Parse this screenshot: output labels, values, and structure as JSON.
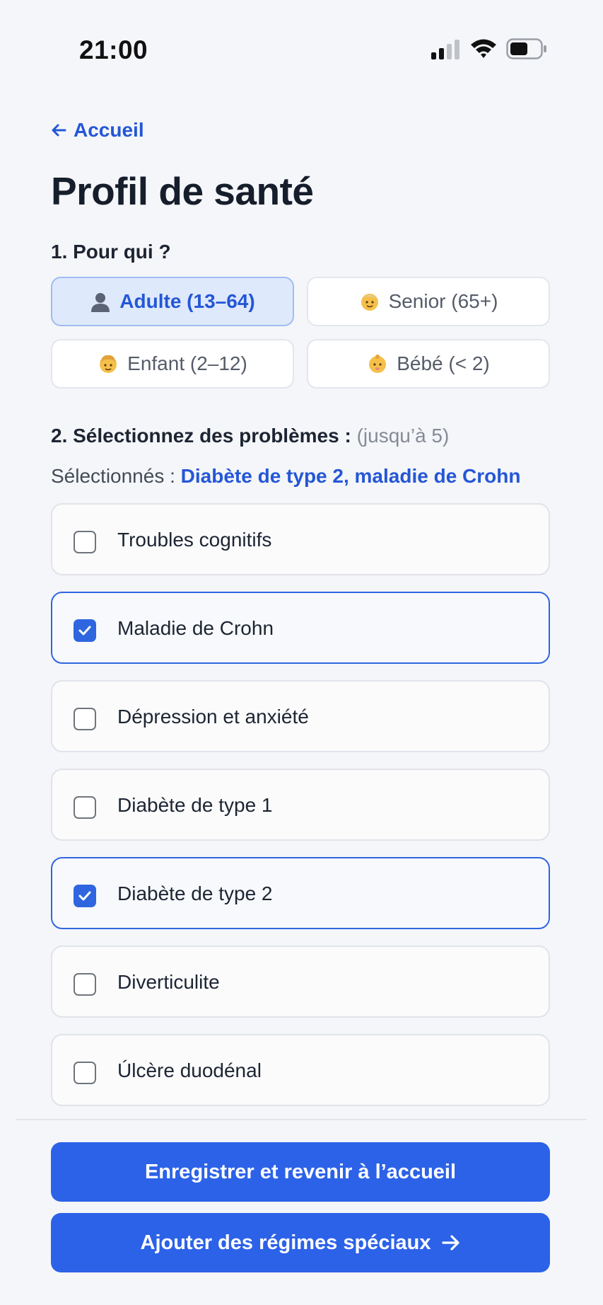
{
  "status_bar": {
    "time": "21:00"
  },
  "nav": {
    "back_label": "Accueil"
  },
  "page": {
    "title": "Profil de santé"
  },
  "who": {
    "heading": "1. Pour qui ?",
    "options": [
      {
        "label": "Adulte (13–64)",
        "icon": "adult-icon",
        "selected": true
      },
      {
        "label": "Senior (65+)",
        "icon": "senior-icon",
        "selected": false
      },
      {
        "label": "Enfant (2–12)",
        "icon": "child-icon",
        "selected": false
      },
      {
        "label": "Bébé (< 2)",
        "icon": "baby-icon",
        "selected": false
      }
    ]
  },
  "problems": {
    "heading": "2. Sélectionnez des problèmes :",
    "hint": "(jusqu’à 5)",
    "selected_prefix": "Sélectionnés :",
    "selected_value": "Diabète de type 2, maladie de Crohn",
    "items": [
      {
        "label": "Troubles cognitifs",
        "checked": false
      },
      {
        "label": "Maladie de Crohn",
        "checked": true
      },
      {
        "label": "Dépression et anxiété",
        "checked": false
      },
      {
        "label": "Diabète de type 1",
        "checked": false
      },
      {
        "label": "Diabète de type 2",
        "checked": true
      },
      {
        "label": "Diverticulite",
        "checked": false
      },
      {
        "label": "Úlcère duodénal",
        "checked": false
      }
    ]
  },
  "actions": {
    "save_label": "Enregistrer et revenir à l’accueil",
    "next_label": "Ajouter des régimes spéciaux"
  },
  "colors": {
    "accent": "#2c62e8",
    "link": "#2457d6",
    "selected_bg": "#dfe9fc"
  }
}
